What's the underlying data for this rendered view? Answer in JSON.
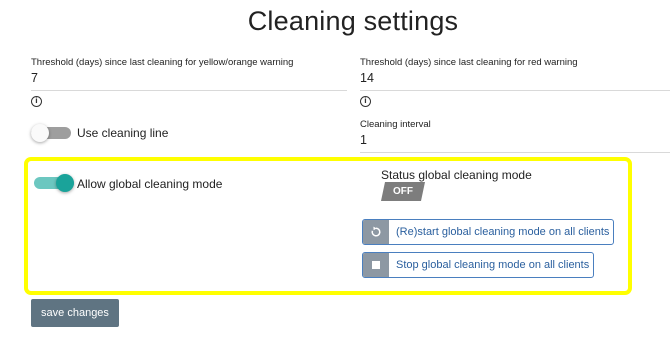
{
  "page": {
    "title": "Cleaning settings"
  },
  "fields": {
    "yellow_threshold": {
      "label": "Threshold (days) since last cleaning for yellow/orange warning",
      "value": "7"
    },
    "red_threshold": {
      "label": "Threshold (days) since last cleaning for red warning",
      "value": "14"
    },
    "cleaning_interval": {
      "label": "Cleaning interval",
      "value": "1"
    }
  },
  "toggles": {
    "use_cleaning_line": {
      "label": "Use cleaning line",
      "on": false
    },
    "allow_global_cleaning": {
      "label": "Allow global cleaning mode",
      "on": true
    }
  },
  "global_mode": {
    "status_label": "Status global cleaning mode",
    "status_value": "OFF",
    "restart_label": "(Re)start global cleaning mode on all clients",
    "stop_label": "Stop global cleaning mode on all clients"
  },
  "actions": {
    "save_label": "save changes"
  },
  "icons": {
    "info": "info-icon",
    "restart": "restart-icon",
    "stop": "stop-icon"
  },
  "colors": {
    "highlight": "#ffff00",
    "toggle_on": "#1aa39a",
    "toggle_off": "#9e9e9e",
    "button_border": "#4a7fbf",
    "button_text": "#2a5f9e",
    "save_bg": "#5f7482",
    "status_badge": "#7d7d7d"
  }
}
